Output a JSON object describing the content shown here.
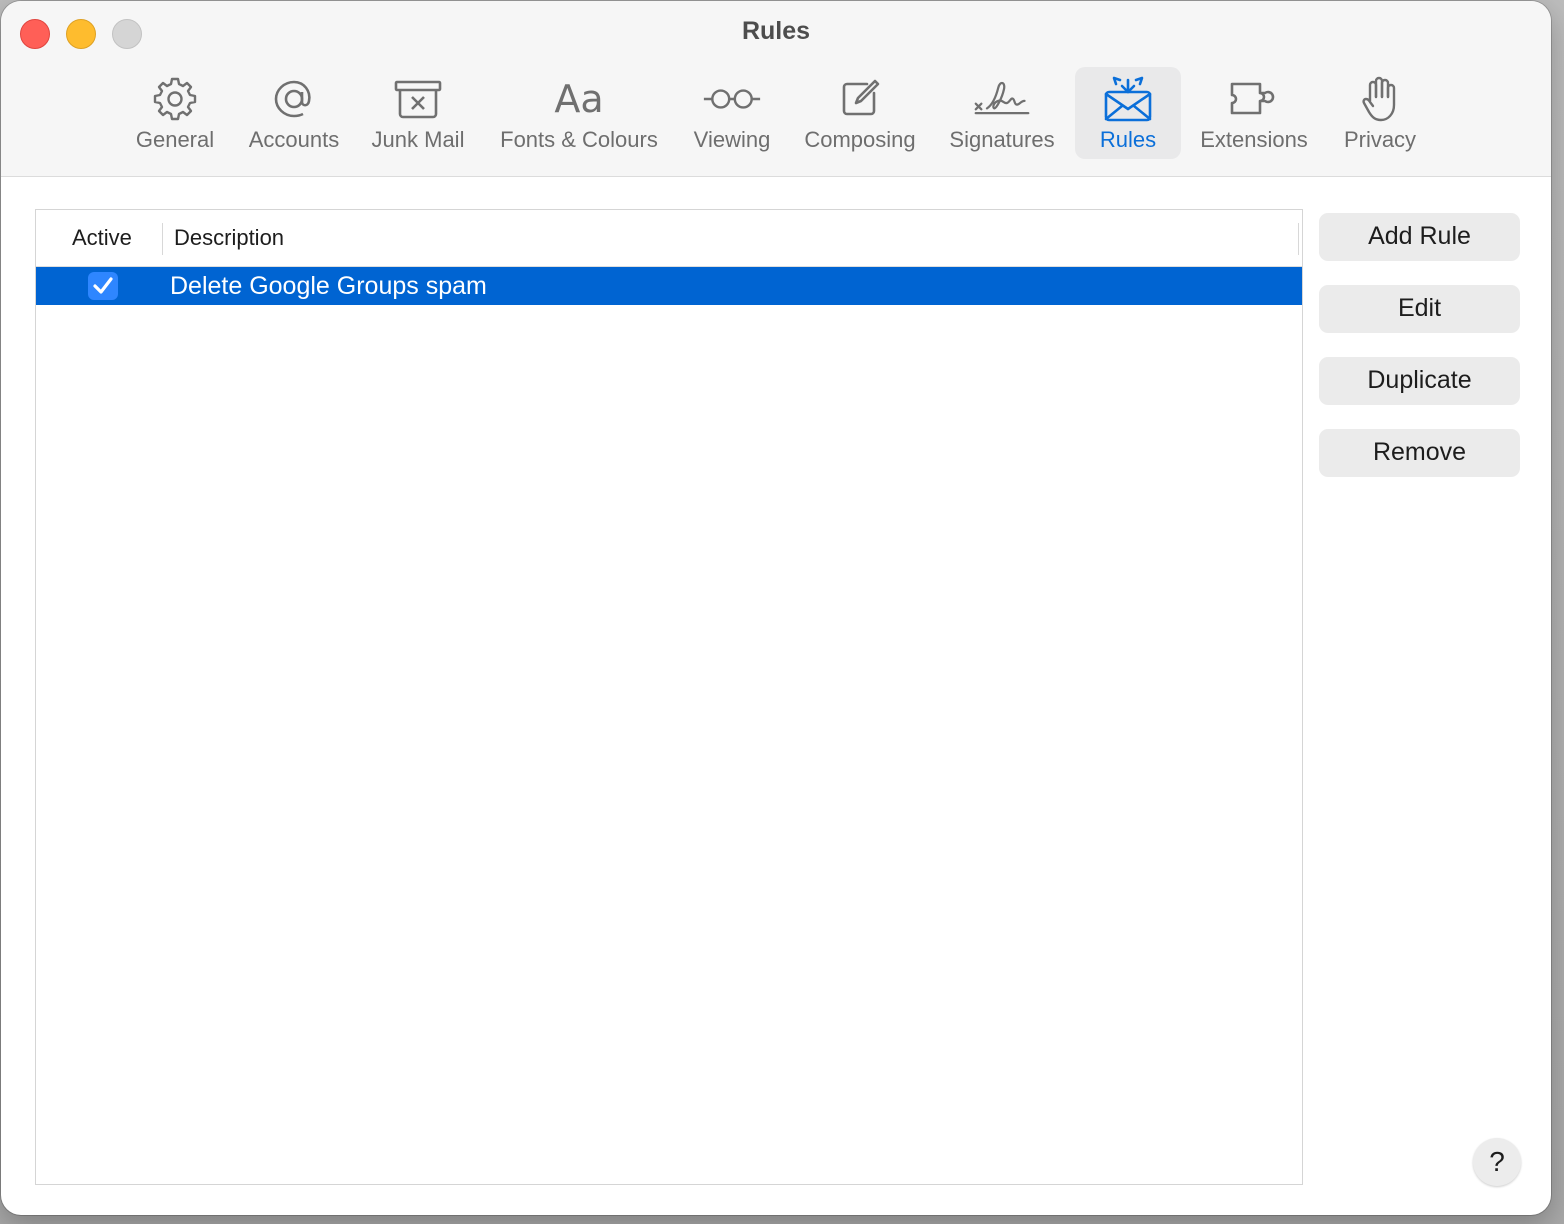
{
  "window": {
    "title": "Rules"
  },
  "toolbar": {
    "tabs": [
      {
        "label": "General",
        "icon": "gear-icon"
      },
      {
        "label": "Accounts",
        "icon": "at-sign-icon"
      },
      {
        "label": "Junk Mail",
        "icon": "junk-mail-icon"
      },
      {
        "label": "Fonts & Colours",
        "icon": "fonts-icon",
        "glyph": "Aa"
      },
      {
        "label": "Viewing",
        "icon": "glasses-icon"
      },
      {
        "label": "Composing",
        "icon": "compose-icon"
      },
      {
        "label": "Signatures",
        "icon": "signature-icon"
      },
      {
        "label": "Rules",
        "icon": "rules-envelope-icon",
        "selected": true
      },
      {
        "label": "Extensions",
        "icon": "puzzle-piece-icon"
      },
      {
        "label": "Privacy",
        "icon": "hand-icon"
      }
    ]
  },
  "rules_table": {
    "columns": {
      "active": "Active",
      "description": "Description"
    },
    "rows": [
      {
        "active": true,
        "description": "Delete Google Groups spam",
        "selected": true
      }
    ]
  },
  "buttons": {
    "add_rule": "Add Rule",
    "edit": "Edit",
    "duplicate": "Duplicate",
    "remove": "Remove",
    "help": "?"
  },
  "colors": {
    "accent": "#0b6fd9",
    "selection": "#0064d2",
    "close": "#ff5f57",
    "minimize": "#febc2e"
  }
}
